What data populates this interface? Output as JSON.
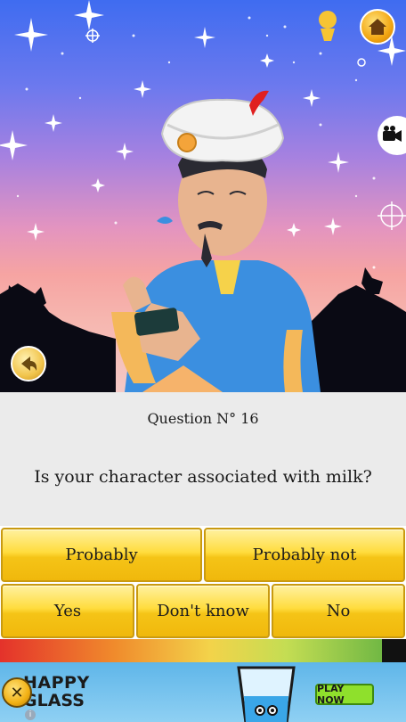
{
  "question": {
    "number_label": "Question N° 16",
    "text": "Is your character associated with milk?"
  },
  "answers": {
    "probably": "Probably",
    "probably_not": "Probably not",
    "yes": "Yes",
    "dont_know": "Don't know",
    "no": "No"
  },
  "progress": {
    "fraction": 0.94
  },
  "ad": {
    "title_line1": "HAPPY",
    "title_line2": "GLASS",
    "cta": "PLAY NOW",
    "close_glyph": "✕",
    "info_glyph": "i"
  },
  "icons": {
    "home": "home-icon",
    "video": "video-camera-icon",
    "back": "back-arrow-icon",
    "kid": "kid-avatar-icon"
  },
  "colors": {
    "button_gold": "#f5c417",
    "panel_bg": "#ebebeb",
    "sky_top": "#3f6cf0",
    "sky_bottom": "#f4c9c6"
  }
}
